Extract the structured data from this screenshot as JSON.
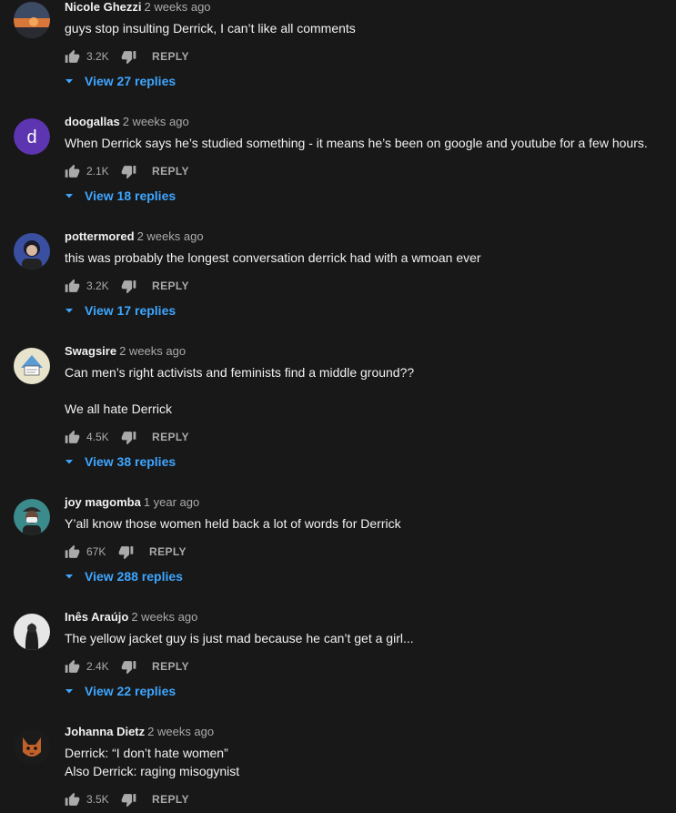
{
  "comments": [
    {
      "author": "Nicole Ghezzi",
      "time": "2 weeks ago",
      "lines": [
        "guys stop insulting Derrick, I can’t like all comments"
      ],
      "likes": "3.2K",
      "reply_label": "REPLY",
      "replies_label": "View 27 replies",
      "avatar_icon": "avatar-sunset-icon",
      "avatar_color": "#d9763a"
    },
    {
      "author": "doogallas",
      "time": "2 weeks ago",
      "lines": [
        "When Derrick says he’s studied something - it means he’s been on google and youtube for a few hours."
      ],
      "likes": "2.1K",
      "reply_label": "REPLY",
      "replies_label": "View 18 replies",
      "avatar_letter": "d",
      "avatar_color": "#5e35b1"
    },
    {
      "author": "pottermored",
      "time": "2 weeks ago",
      "lines": [
        "this was probably the longest conversation derrick had with a wmoan ever"
      ],
      "likes": "3.2K",
      "reply_label": "REPLY",
      "replies_label": "View 17 replies",
      "avatar_icon": "avatar-portrait-icon",
      "avatar_color": "#3a4fa0"
    },
    {
      "author": "Swagsire",
      "time": "2 weeks ago",
      "lines": [
        "Can men’s right activists and feminists find a middle ground??",
        "",
        "We all hate Derrick"
      ],
      "likes": "4.5K",
      "reply_label": "REPLY",
      "replies_label": "View 38 replies",
      "avatar_icon": "avatar-shark-icon",
      "avatar_color": "#e8e4cc"
    },
    {
      "author": "joy magomba",
      "time": "1 year ago",
      "lines": [
        "Y’all know those women held back a lot of words for Derrick"
      ],
      "likes": "67K",
      "reply_label": "REPLY",
      "replies_label": "View 288 replies",
      "avatar_icon": "avatar-masked-person-icon",
      "avatar_color": "#3b8a8c"
    },
    {
      "author": "Inês Araújo",
      "time": "2 weeks ago",
      "lines": [
        "The yellow jacket guy is just mad because he can’t get a girl..."
      ],
      "likes": "2.4K",
      "reply_label": "REPLY",
      "replies_label": "View 22 replies",
      "avatar_icon": "avatar-silhouette-icon",
      "avatar_color": "#e6e6e6"
    },
    {
      "author": "Johanna Dietz",
      "time": "2 weeks ago",
      "lines": [
        "Derrick: “I don’t hate women”",
        "Also Derrick: raging misogynist"
      ],
      "likes": "3.5K",
      "reply_label": "REPLY",
      "avatar_icon": "avatar-fox-icon",
      "avatar_color": "#c0602a"
    }
  ],
  "colors": {
    "background": "#181818",
    "link": "#3ea6ff",
    "secondary_text": "#aaaaaa"
  }
}
